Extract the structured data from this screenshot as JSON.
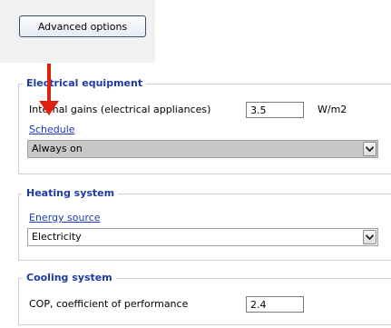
{
  "toolbar": {
    "advanced_label": "Advanced options"
  },
  "electrical": {
    "title": "Electrical equipment",
    "internal_gains_label": "Internal gains (electrical appliances)",
    "internal_gains_value": "3.5",
    "internal_gains_unit": "W/m2",
    "schedule_link": "Schedule",
    "schedule_value": "Always on"
  },
  "heating": {
    "title": "Heating system",
    "energy_source_link": "Energy source",
    "energy_source_value": "Electricity"
  },
  "cooling": {
    "title": "Cooling system",
    "cop_label": "COP, coefficient of performance",
    "cop_value": "2.4"
  },
  "colors": {
    "group_title": "#1c3aa5",
    "link": "#1a3cbe",
    "annotation_arrow": "#e02010",
    "selected_dropdown_bg": "#c8c8c8"
  },
  "icons": {
    "dropdown": "chevron-down-icon",
    "annotation": "red-arrow-annotation"
  }
}
